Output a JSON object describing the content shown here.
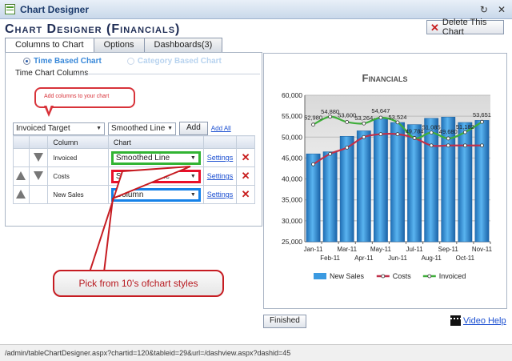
{
  "window": {
    "title": "Chart Designer",
    "controls": [
      "↻",
      "✕"
    ]
  },
  "page": {
    "heading": "Chart Designer (Financials)"
  },
  "toolbar": {
    "delete_label": "Delete This Chart"
  },
  "tabs": [
    {
      "label": "Columns to Chart",
      "active": true
    },
    {
      "label": "Options",
      "active": false
    },
    {
      "label": "Dashboards(3)",
      "active": false
    }
  ],
  "chart_mode": {
    "time_based": "Time Based Chart",
    "category_based": "Category Based Chart",
    "selected": "time_based"
  },
  "section": {
    "title": "Time Chart Columns"
  },
  "callouts": {
    "top": "Add columns to your chart",
    "bottom": "Pick from 10's ofchart styles"
  },
  "add_controls": {
    "column_select": "Invoiced Target",
    "style_select": "Smoothed Line",
    "add_label": "Add",
    "add_all_label": "Add All"
  },
  "grid": {
    "headers": {
      "column": "Column",
      "chart": "Chart"
    },
    "rows": [
      {
        "column": "Invoiced",
        "chart": "Smoothed Line",
        "settings": "Settings",
        "up": false,
        "down": true,
        "highlight": "#32b433"
      },
      {
        "column": "Costs",
        "chart": "Smoothed Line",
        "settings": "Settings",
        "up": true,
        "down": true,
        "highlight": "#e8102a"
      },
      {
        "column": "New Sales",
        "chart": "Column",
        "settings": "Settings",
        "up": true,
        "down": false,
        "highlight": "#1581e8"
      }
    ]
  },
  "buttons": {
    "finished": "Finished",
    "video_help": "Video Help"
  },
  "status": {
    "url": "/admin/tableChartDesigner.aspx?chartid=120&tableid=29&url=/dashview.aspx?dashid=45"
  },
  "chart_data": {
    "type": "bar",
    "title": "Financials",
    "categories": [
      "Jan-11",
      "Feb-11",
      "Mar-11",
      "Apr-11",
      "May-11",
      "Jun-11",
      "Jul-11",
      "Aug-11",
      "Sep-11",
      "Oct-11",
      "Nov-11"
    ],
    "ylim": [
      25000,
      60000
    ],
    "yticks": [
      "25,000",
      "30,000",
      "35,000",
      "40,000",
      "45,000",
      "50,000",
      "55,000",
      "60,000"
    ],
    "grid": true,
    "legend_position": "bottom",
    "series": [
      {
        "name": "New Sales",
        "kind": "bar",
        "color": "#3b9ae1",
        "values": [
          46000,
          46500,
          50200,
          51500,
          54500,
          53500,
          53000,
          54500,
          54800,
          53500,
          54000
        ]
      },
      {
        "name": "Costs",
        "kind": "line",
        "color": "#c0304a",
        "values": [
          43500,
          46000,
          47500,
          50000,
          50700,
          50700,
          49784,
          48000,
          48000,
          48000,
          48000
        ]
      },
      {
        "name": "Invoiced",
        "kind": "line",
        "color": "#3fae3a",
        "values": [
          52980,
          54880,
          53600,
          53264,
          54647,
          53524,
          49784,
          51085,
          49680,
          51182,
          53651
        ]
      }
    ],
    "data_labels": [
      {
        "text": "52,980",
        "x": "Jan-11",
        "y": 52980
      },
      {
        "text": "54,880",
        "x": "Feb-11",
        "y": 54880
      },
      {
        "text": "53,600",
        "x": "Mar-11",
        "y": 53600
      },
      {
        "text": "53,264",
        "x": "Apr-11",
        "y": 53264
      },
      {
        "text": "54,647",
        "x": "May-11",
        "y": 54647
      },
      {
        "text": "53,524",
        "x": "Jun-11",
        "y": 53524
      },
      {
        "text": "49,784",
        "x": "Jul-11",
        "y": 49784
      },
      {
        "text": "51,085",
        "x": "Aug-11",
        "y": 51085
      },
      {
        "text": "49,680",
        "x": "Sep-11",
        "y": 49680
      },
      {
        "text": "51,182",
        "x": "Oct-11",
        "y": 51182
      },
      {
        "text": "53,651",
        "x": "Nov-11",
        "y": 53651
      }
    ]
  }
}
